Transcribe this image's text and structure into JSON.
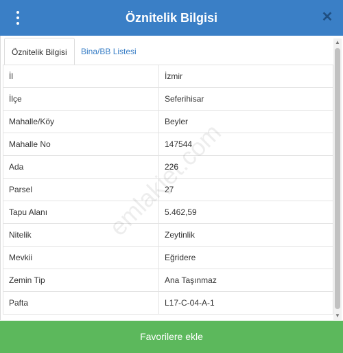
{
  "header": {
    "title": "Öznitelik Bilgisi",
    "menu_icon": "vertical-ellipsis",
    "close_icon": "close-x"
  },
  "tabs": [
    {
      "label": "Öznitelik Bilgisi",
      "active": true
    },
    {
      "label": "Bina/BB Listesi",
      "active": false
    }
  ],
  "rows": [
    {
      "key": "İl",
      "value": "İzmir"
    },
    {
      "key": "İlçe",
      "value": "Seferihisar"
    },
    {
      "key": "Mahalle/Köy",
      "value": "Beyler"
    },
    {
      "key": "Mahalle No",
      "value": "147544"
    },
    {
      "key": "Ada",
      "value": "226"
    },
    {
      "key": "Parsel",
      "value": "27"
    },
    {
      "key": "Tapu Alanı",
      "value": "5.462,59"
    },
    {
      "key": "Nitelik",
      "value": "Zeytinlik"
    },
    {
      "key": "Mevkii",
      "value": "Eğridere"
    },
    {
      "key": "Zemin Tip",
      "value": "Ana Taşınmaz"
    },
    {
      "key": "Pafta",
      "value": "L17-C-04-A-1"
    }
  ],
  "watermark": "emlakjet.com",
  "footer": {
    "button_label": "Favorilere ekle"
  },
  "colors": {
    "header": "#3a7fc6",
    "footer": "#5cb85c"
  }
}
